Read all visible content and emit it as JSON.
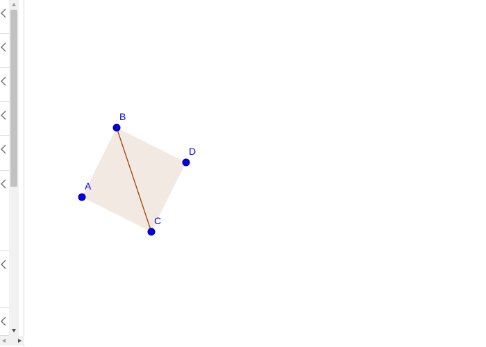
{
  "algebra": {
    "row_count": 8
  },
  "colors": {
    "point": "#0000ff",
    "point_label": "#0000ee",
    "segment": "#a04000",
    "polygon_fill": "#f3e9e3"
  },
  "icons": {
    "collapse": "chevron-left-icon",
    "scroll_up": "triangle-up-icon",
    "scroll_down": "triangle-down-icon"
  },
  "construction": {
    "points": [
      {
        "id": "A",
        "label": "A"
      },
      {
        "id": "B",
        "label": "B"
      },
      {
        "id": "C",
        "label": "C"
      },
      {
        "id": "D",
        "label": "D"
      }
    ],
    "polygon": [
      "A",
      "B",
      "D",
      "C"
    ],
    "segment": [
      "B",
      "C"
    ]
  }
}
